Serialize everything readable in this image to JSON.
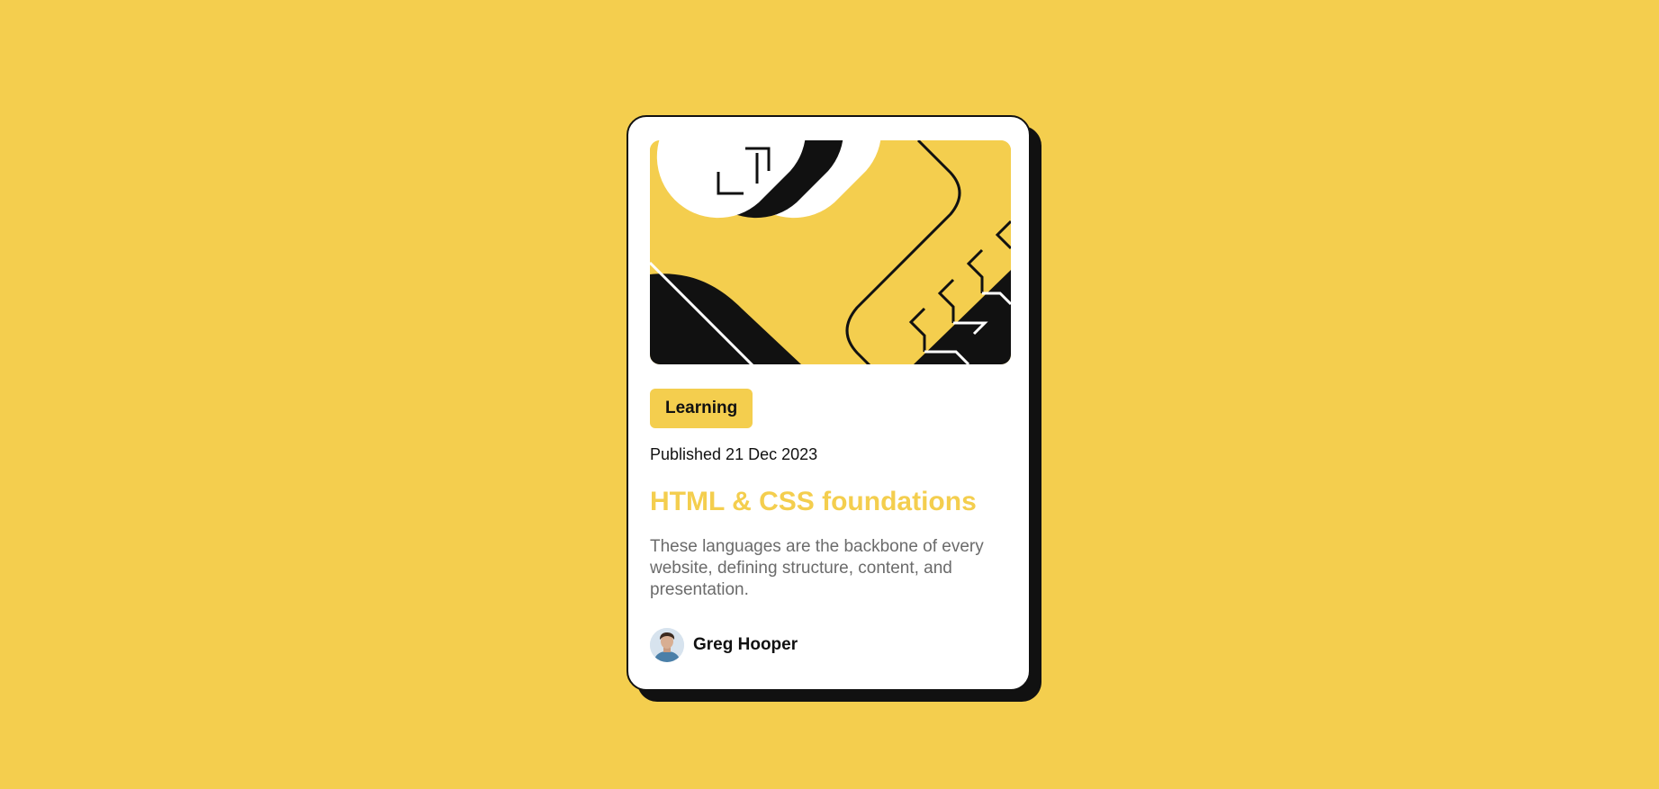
{
  "colors": {
    "background": "#F4CE4E",
    "card": "#FFFFFF",
    "ink": "#111111",
    "accent": "#F4CE4E",
    "muted_text": "#6B6B6B"
  },
  "card": {
    "illustration": "abstract-geometric-illustration",
    "tag": "Learning",
    "published": "Published 21 Dec 2023",
    "title": "HTML & CSS foundations",
    "description": "These languages are the backbone of every website, defining structure, content, and presentation.",
    "author": {
      "name": "Greg Hooper",
      "avatar": "avatar-photo"
    }
  }
}
